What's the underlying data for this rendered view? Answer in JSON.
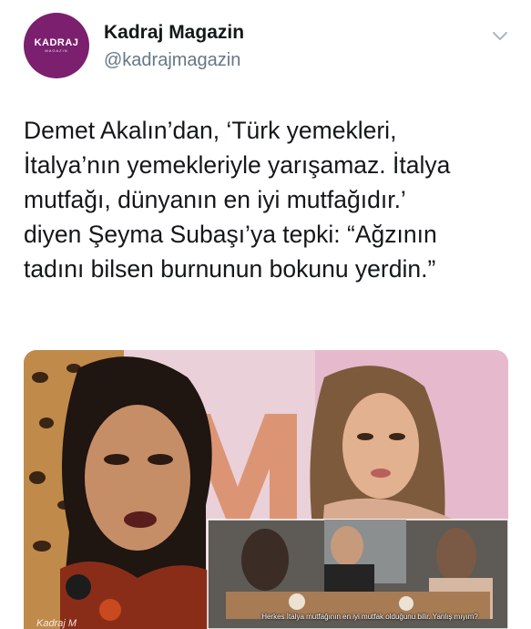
{
  "account": {
    "avatar_text": "KADRAJ",
    "avatar_subtext": "MAGAZIN",
    "display_name": "Kadraj Magazin",
    "handle": "@kadrajmagazin"
  },
  "tweet": {
    "text": "Demet Akalın’dan, ‘Türk yemekleri,\nİtalya’nın yemekleriyle yarışamaz. İtalya\nmutfağı, dünyanın en iyi mutfağıdır.’\ndiyen Şeyma Subaşı’ya tepki: “Ağzının\ntadını bilsen burnunun bokunu yerdin.”"
  },
  "media": {
    "inset_caption": "Herkes İtalya mutfağının en iyi mutfak olduğunu bilir. Yanlış mıyım?",
    "watermark": "Kadraj M"
  },
  "icons": {
    "menu": "chevron-down-icon"
  },
  "colors": {
    "avatar_bg": "#7b1f6e",
    "handle": "#657786",
    "text": "#14171a"
  }
}
